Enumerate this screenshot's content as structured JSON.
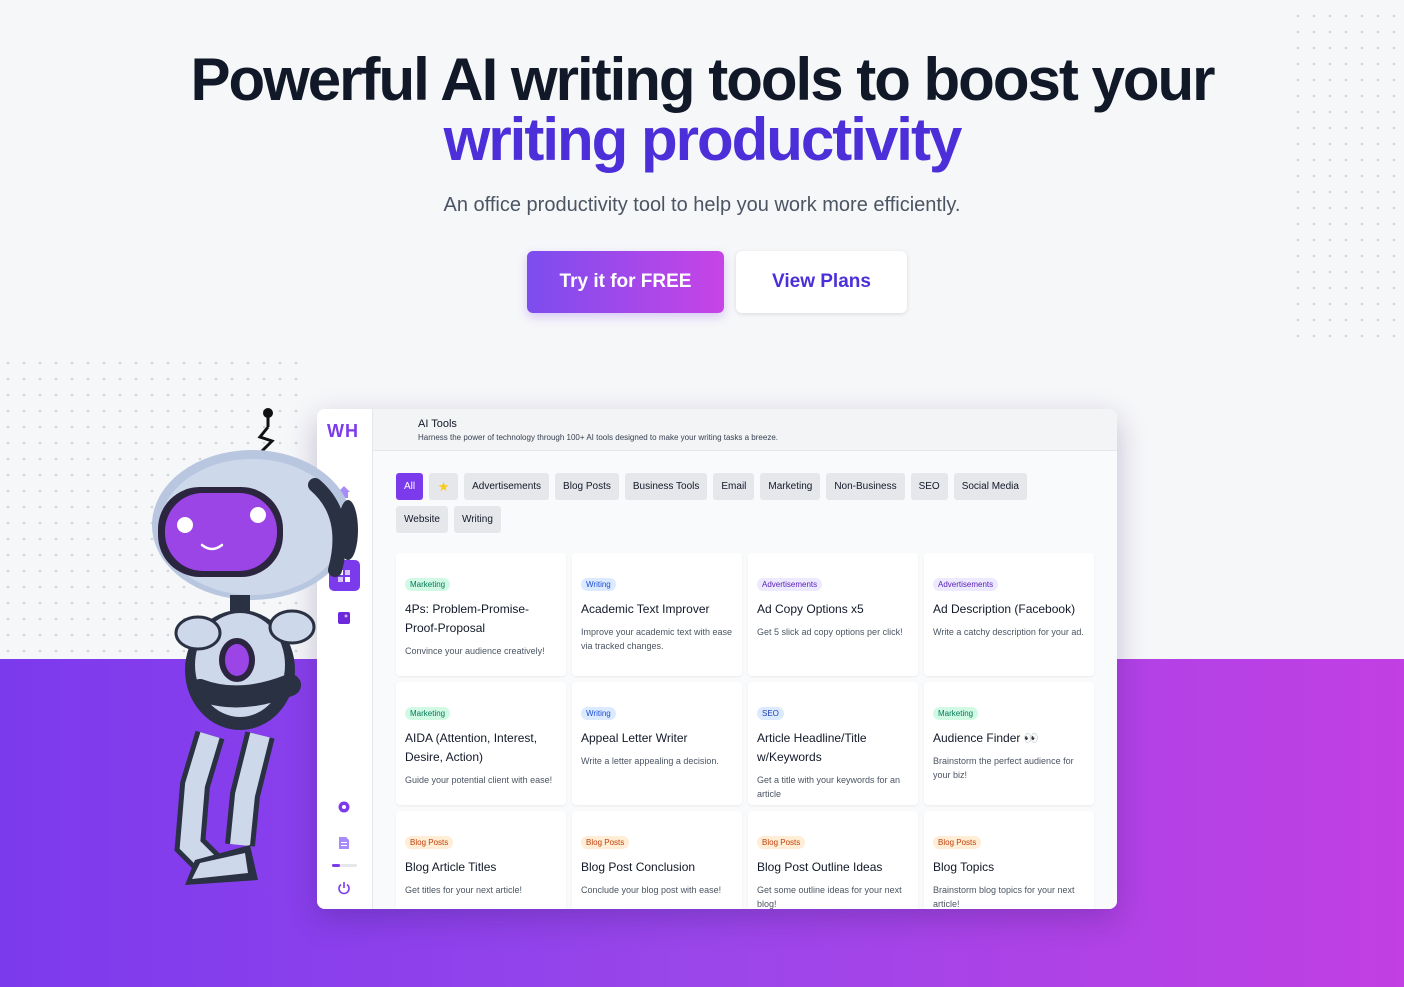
{
  "hero": {
    "title_line1": "Powerful AI writing tools to boost your",
    "title_line2": "writing productivity",
    "subtitle": "An office productivity tool to help you work more efficiently.",
    "primary_cta": "Try it for FREE",
    "secondary_cta": "View Plans"
  },
  "colors": {
    "accent": "#4c2fd8",
    "brand_purple": "#7c3aed",
    "band_gradient_start": "#7c3aed",
    "band_gradient_end": "#c13fe3"
  },
  "app": {
    "logo": "WH",
    "header_title": "AI Tools",
    "header_subtitle": "Harness the power of technology through 100+ AI tools designed to make your writing tasks a breeze.",
    "sidebar_icons": [
      "home-icon",
      "grid-icon",
      "image-icon",
      "gear-icon",
      "document-icon",
      "power-icon"
    ],
    "filters": [
      "All",
      "Advertisements",
      "Blog Posts",
      "Business Tools",
      "Email",
      "Marketing",
      "Non-Business",
      "SEO",
      "Social Media",
      "Website",
      "Writing"
    ],
    "active_filter": "All",
    "cards": [
      {
        "tag": "Marketing",
        "title": "4Ps: Problem-Promise-Proof-Proposal",
        "desc": "Convince your audience creatively!"
      },
      {
        "tag": "Writing",
        "title": "Academic Text Improver",
        "desc": "Improve your academic text with ease via tracked changes."
      },
      {
        "tag": "Advertisements",
        "title": "Ad Copy Options x5",
        "desc": "Get 5 slick ad copy options per click!"
      },
      {
        "tag": "Advertisements",
        "title": "Ad Description (Facebook)",
        "desc": "Write a catchy description for your ad."
      },
      {
        "tag": "Marketing",
        "title": "AIDA (Attention, Interest, Desire, Action)",
        "desc": "Guide your potential client with ease!"
      },
      {
        "tag": "Writing",
        "title": "Appeal Letter Writer",
        "desc": "Write a letter appealing a decision."
      },
      {
        "tag": "SEO",
        "title": "Article Headline/Title w/Keywords",
        "desc": "Get a title with your keywords for an article"
      },
      {
        "tag": "Marketing",
        "title": "Audience Finder 👀",
        "desc": "Brainstorm the perfect audience for your biz!"
      },
      {
        "tag": "Blog Posts",
        "title": "Blog Article Titles",
        "desc": "Get titles for your next article!"
      },
      {
        "tag": "Blog Posts",
        "title": "Blog Post Conclusion",
        "desc": "Conclude your blog post with ease!"
      },
      {
        "tag": "Blog Posts",
        "title": "Blog Post Outline Ideas",
        "desc": "Get some outline ideas for your next blog!"
      },
      {
        "tag": "Blog Posts",
        "title": "Blog Topics",
        "desc": "Brainstorm blog topics for your next article!"
      }
    ]
  }
}
